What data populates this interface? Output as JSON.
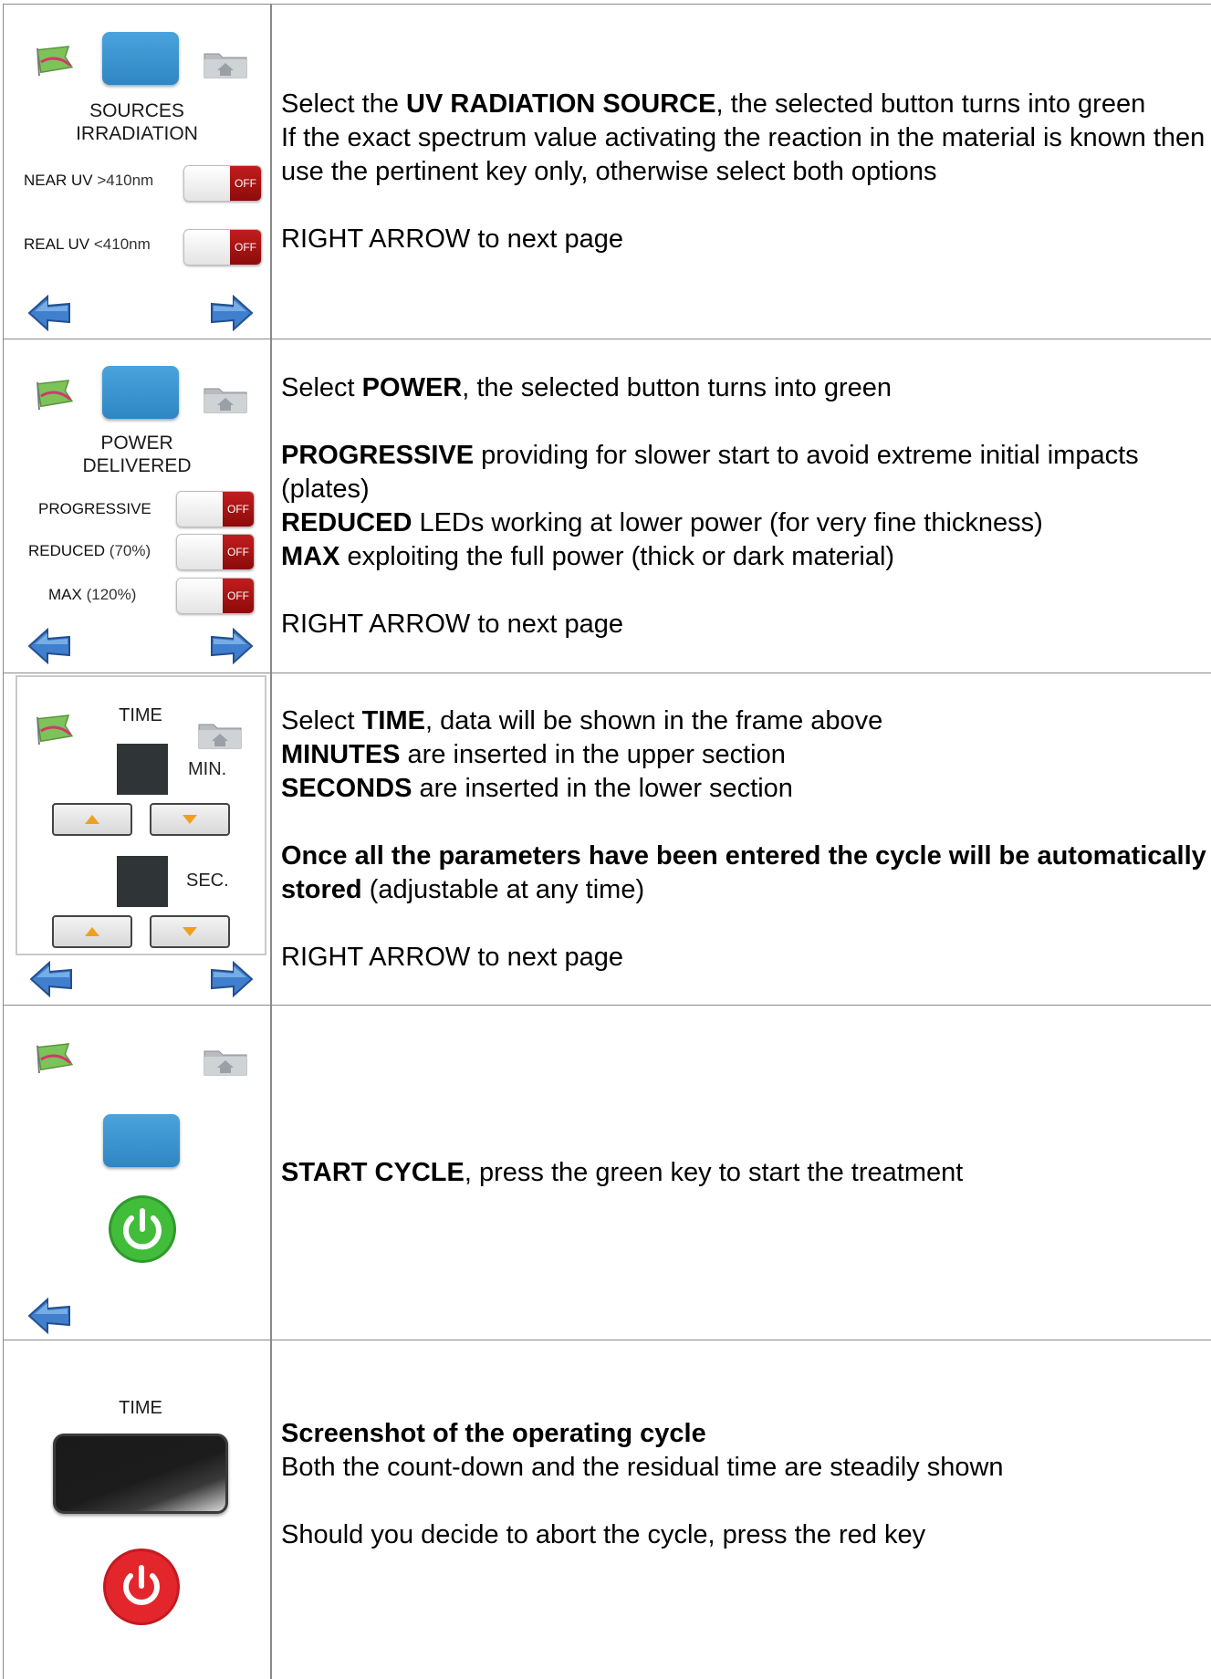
{
  "rows": [
    {
      "panel": {
        "title_line1": "SOURCES",
        "title_line2": "IRRADIATION",
        "options": [
          {
            "label": "NEAR UV",
            "sub": ">410nm",
            "state": "OFF"
          },
          {
            "label": "REAL UV",
            "sub": "<410nm",
            "state": "OFF"
          }
        ]
      },
      "text": {
        "p1_pre": "Select the ",
        "p1_bold": "UV RADIATION SOURCE",
        "p1_post": ", the selected button turns into green",
        "p2": "If the exact spectrum value activating the reaction in the material is known then use the pertinent key only, otherwise select both options",
        "p3": "RIGHT ARROW to next page"
      }
    },
    {
      "panel": {
        "title_line1": "POWER",
        "title_line2": "DELIVERED",
        "options": [
          {
            "label": "PROGRESSIVE",
            "sub": "",
            "state": "OFF"
          },
          {
            "label": "REDUCED",
            "sub": "(70%)",
            "state": "OFF"
          },
          {
            "label": "MAX",
            "sub": "(120%)",
            "state": "OFF"
          }
        ]
      },
      "text": {
        "p1_pre": "Select ",
        "p1_bold": "POWER",
        "p1_post": ", the selected button turns into green",
        "p2_bold": "PROGRESSIVE",
        "p2_rest": " providing for slower start to avoid extreme initial impacts (plates)",
        "p3_bold": "REDUCED",
        "p3_rest": " LEDs working at lower power (for very fine thickness)",
        "p4_bold": "MAX",
        "p4_rest": " exploiting the full power (thick or dark material)",
        "p5": "RIGHT ARROW to next page"
      }
    },
    {
      "panel": {
        "title": "TIME",
        "min_label": "MIN.",
        "sec_label": "SEC."
      },
      "text": {
        "p1_pre": "Select ",
        "p1_bold": "TIME",
        "p1_post": ", data will be shown in the frame above",
        "p2_bold": "MINUTES",
        "p2_rest": " are inserted in the upper section",
        "p3_bold": "SECONDS",
        "p3_rest": " are inserted in the lower section",
        "p4_bold": "Once all the parameters have been entered the cycle will be automatically stored",
        "p4_rest": " (adjustable at any time)",
        "p5": "RIGHT ARROW to next page"
      }
    },
    {
      "text": {
        "p1_bold": "START CYCLE",
        "p1_post": ", press the green key to start the treatment"
      }
    },
    {
      "panel": {
        "title": "TIME"
      },
      "text": {
        "p1_bold": "Screenshot of the operating cycle",
        "p2": "Both the count-down and the residual time are steadily shown",
        "p3": "Should you decide to abort the cycle, press the red key"
      }
    }
  ],
  "colors": {
    "blue_button": "#3592cf",
    "toggle_off": "#a51212",
    "start_green": "#3cb83a",
    "stop_red": "#e1262c",
    "arrow_blue": "#3a78c6"
  }
}
